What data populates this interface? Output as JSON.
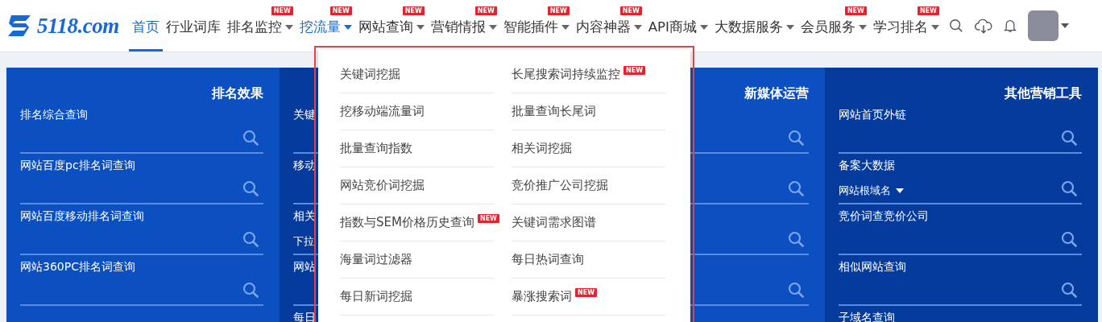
{
  "nav": {
    "logo": "5118.com",
    "items": [
      {
        "label": "首页",
        "selected": true,
        "expanded": false,
        "has_caret": false
      },
      {
        "label": "行业词库",
        "selected": false,
        "expanded": false,
        "has_caret": false
      },
      {
        "label": "排名监控",
        "selected": false,
        "expanded": false,
        "has_caret": true,
        "badge": "NEW"
      },
      {
        "label": "挖流量",
        "selected": false,
        "expanded": true,
        "has_caret": true,
        "badge": "NEW"
      },
      {
        "label": "网站查询",
        "selected": false,
        "expanded": false,
        "has_caret": true,
        "badge": "NEW"
      },
      {
        "label": "营销情报",
        "selected": false,
        "expanded": false,
        "has_caret": true,
        "badge": "NEW"
      },
      {
        "label": "智能插件",
        "selected": false,
        "expanded": false,
        "has_caret": true,
        "badge": "NEW"
      },
      {
        "label": "内容神器",
        "selected": false,
        "expanded": false,
        "has_caret": true,
        "badge": "NEW"
      },
      {
        "label": "API商城",
        "selected": false,
        "expanded": false,
        "has_caret": true
      },
      {
        "label": "大数据服务",
        "selected": false,
        "expanded": false,
        "has_caret": true
      },
      {
        "label": "会员服务",
        "selected": false,
        "expanded": false,
        "has_caret": true,
        "badge": "NEW"
      },
      {
        "label": "学习排名",
        "selected": false,
        "expanded": false,
        "has_caret": true,
        "badge": "NEW"
      }
    ]
  },
  "panel": {
    "columns": [
      {
        "title": "排名效果",
        "items": [
          {
            "label": "排名综合查询"
          },
          {
            "label": "网站百度pc排名词查询"
          },
          {
            "label": "网站百度移动排名词查询"
          },
          {
            "label": "网站360PC排名词查询"
          }
        ]
      },
      {
        "items": [
          {
            "label": "关键"
          },
          {
            "label": "移动"
          },
          {
            "label": "相关",
            "select": "下拉"
          },
          {
            "label": "网站"
          },
          {
            "label": "每日"
          }
        ]
      },
      {
        "title": "新媒体运营",
        "items": [
          {
            "kind": "search_only"
          },
          {
            "kind": "search_only"
          },
          {
            "kind": "search_only"
          },
          {
            "kind": "search_only"
          }
        ]
      },
      {
        "title": "其他营销工具",
        "items": [
          {
            "label": "网站首页外链"
          },
          {
            "label": "备案大数据",
            "select": "网站根域名"
          },
          {
            "label": "竞价词查竞价公司"
          },
          {
            "label": "相似网站查询"
          },
          {
            "label": "子域名查询"
          }
        ]
      }
    ]
  },
  "dropdown": {
    "columns": [
      [
        {
          "label": "关键词挖掘"
        },
        {
          "label": "挖移动端流量词"
        },
        {
          "label": "批量查询指数"
        },
        {
          "label": "网站竞价词挖掘"
        },
        {
          "label": "指数与SEM价格历史查询",
          "badge": "NEW"
        },
        {
          "label": "海量词过滤器"
        },
        {
          "label": "每日新词挖掘"
        }
      ],
      [
        {
          "label": "长尾搜索词持续监控",
          "badge": "NEW"
        },
        {
          "label": "批量查询长尾词"
        },
        {
          "label": "相关词挖掘"
        },
        {
          "label": "竞价推广公司挖掘"
        },
        {
          "label": "关键词需求图谱"
        },
        {
          "label": "每日热词查询"
        },
        {
          "label": "暴涨搜索词",
          "badge": "NEW"
        }
      ]
    ]
  }
}
